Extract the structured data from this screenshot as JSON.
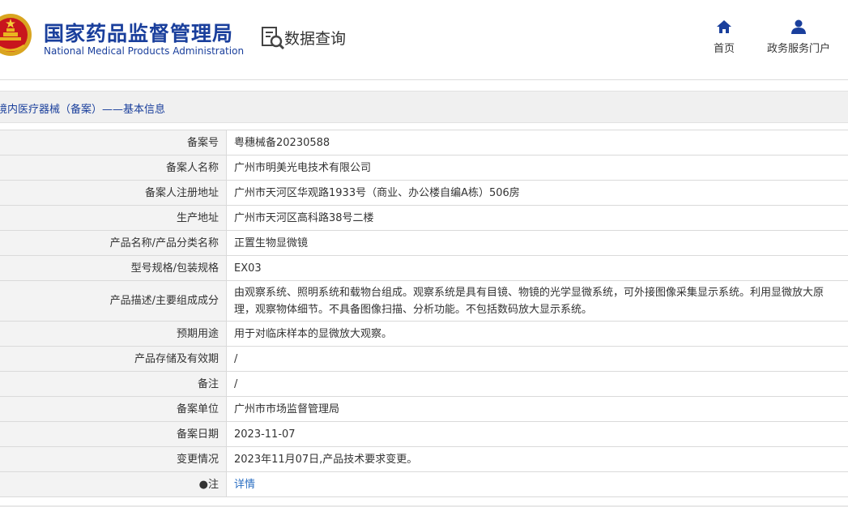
{
  "header": {
    "org_name_cn": "国家药品监督管理局",
    "org_name_en": "National Medical Products Administration",
    "section_title": "数据查询",
    "nav": [
      {
        "label": "首页",
        "icon": "home-icon"
      },
      {
        "label": "政务服务门户",
        "icon": "user-icon"
      }
    ]
  },
  "breadcrumb": {
    "text": "境内医疗器械（备案）——基本信息"
  },
  "colors": {
    "brand": "#1a3f9c",
    "link": "#2a6ec2",
    "label_bg": "#f3f3f3"
  },
  "record": {
    "rows": [
      {
        "label": "备案号",
        "value": "粤穗械备20230588"
      },
      {
        "label": "备案人名称",
        "value": "广州市明美光电技术有限公司"
      },
      {
        "label": "备案人注册地址",
        "value": "广州市天河区华观路1933号（商业、办公楼自编A栋）506房"
      },
      {
        "label": "生产地址",
        "value": "广州市天河区高科路38号二楼"
      },
      {
        "label": "产品名称/产品分类名称",
        "value": "正置生物显微镜"
      },
      {
        "label": "型号规格/包装规格",
        "value": "EX03"
      },
      {
        "label": "产品描述/主要组成成分",
        "value": "由观察系统、照明系统和载物台组成。观察系统是具有目镜、物镜的光学显微系统，可外接图像采集显示系统。利用显微放大原理，观察物体细节。不具备图像扫描、分析功能。不包括数码放大显示系统。"
      },
      {
        "label": "预期用途",
        "value": "用于对临床样本的显微放大观察。"
      },
      {
        "label": "产品存储及有效期",
        "value": "/"
      },
      {
        "label": "备注",
        "value": "/"
      },
      {
        "label": "备案单位",
        "value": "广州市市场监督管理局"
      },
      {
        "label": "备案日期",
        "value": "2023-11-07"
      },
      {
        "label": "变更情况",
        "value": "2023年11月07日,产品技术要求变更。"
      },
      {
        "label": "●注",
        "value": "详情"
      }
    ]
  }
}
